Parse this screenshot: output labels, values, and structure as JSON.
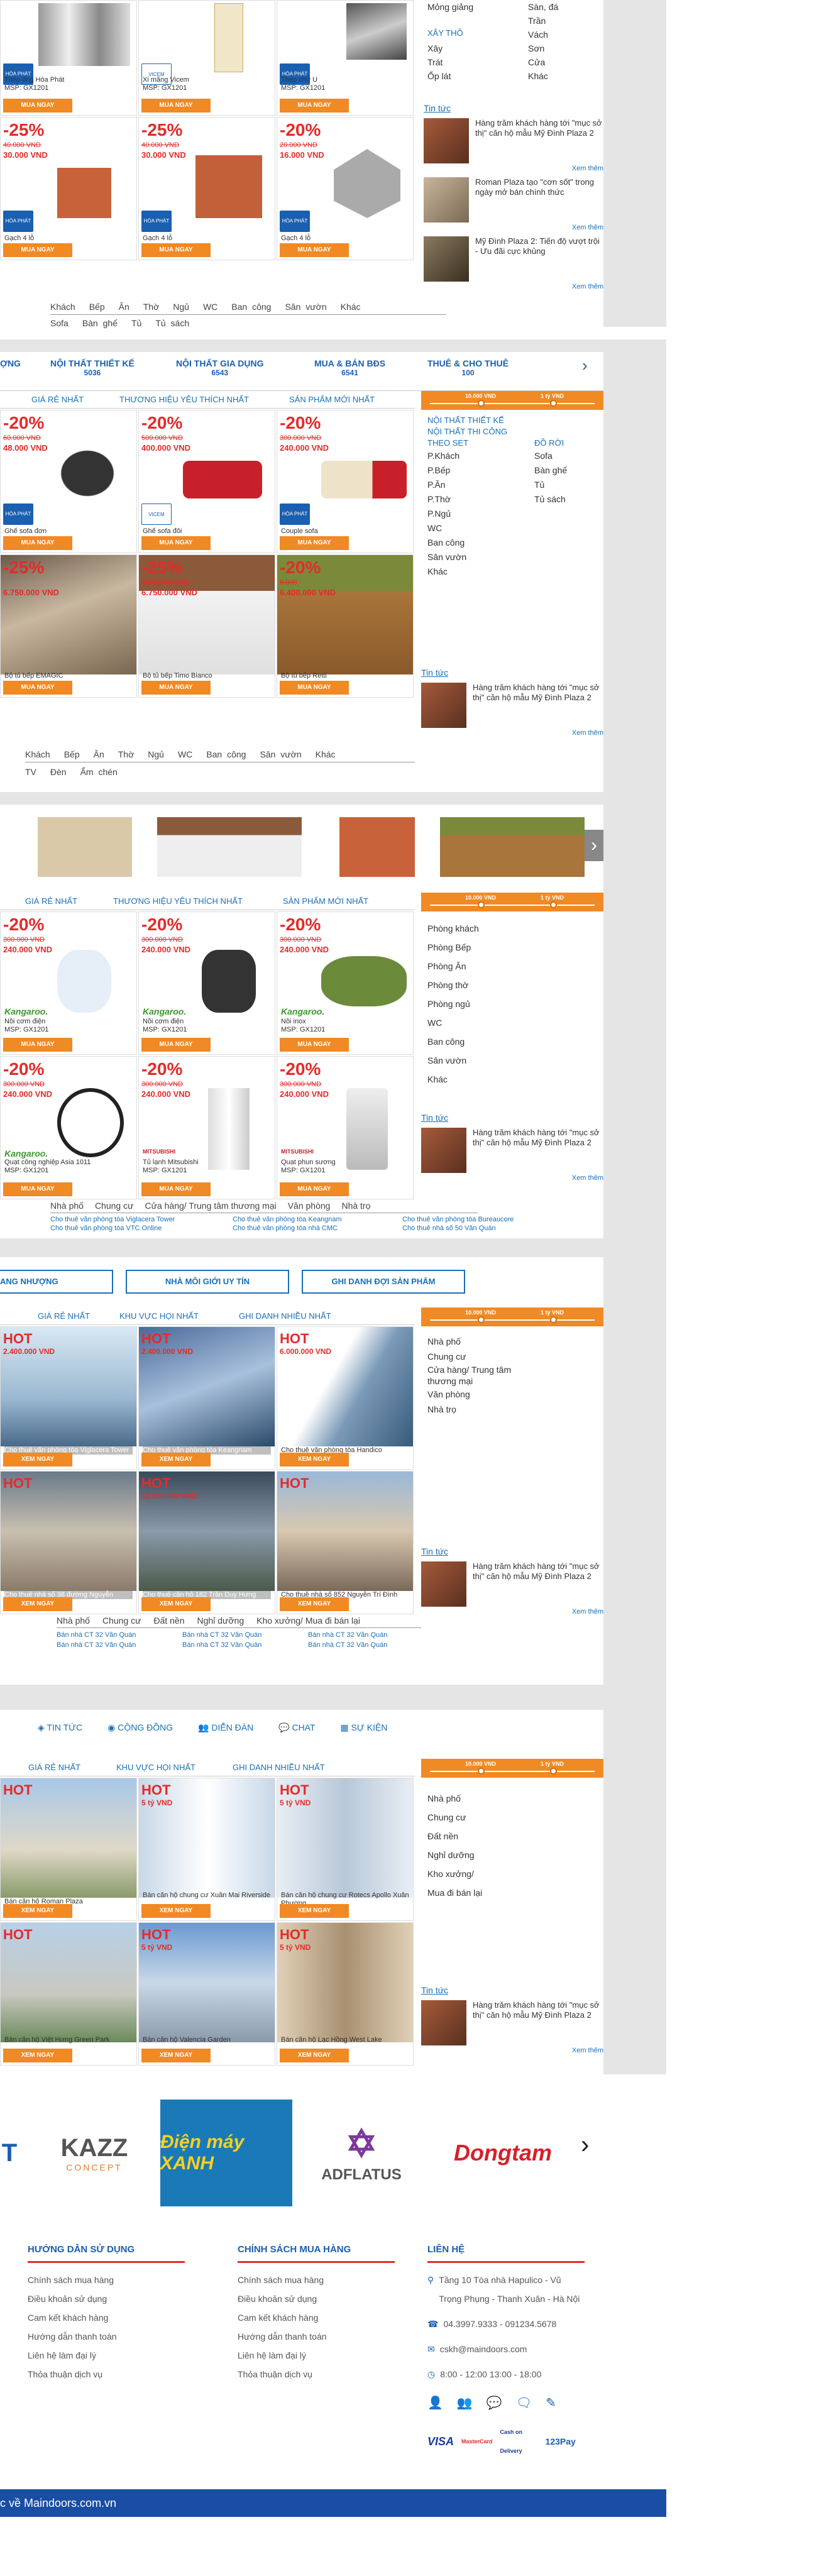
{
  "sec1": {
    "filters_top": [
      "Mỏng giảng",
      "Sàn, đá",
      "Trần",
      "Vách",
      "Sơn",
      "Cửa",
      "Khác"
    ],
    "filter_title": "XÂY THÔ",
    "filter_items": [
      "Xây",
      "Trát",
      "Ốp lát"
    ],
    "news_title": "Tin tức",
    "news": [
      "Hàng trăm khách hàng tới \"mục sở thị\" căn hộ mẫu Mỹ Đình Plaza 2",
      "Roman Plaza tạo \"cơn sốt\" trong ngày mở bán chính thức",
      "Mỹ Đình Plaza 2: Tiến độ vượt trội - Ưu đãi cực khủng"
    ],
    "more": "Xem thêm",
    "cards_top": [
      {
        "name": "Thép ống Hòa Phát",
        "sku": "MSP: GX1201",
        "btn": "MUA NGAY"
      },
      {
        "name": "Xi măng Vicem",
        "sku": "MSP: GX1201",
        "btn": "MUA NGAY"
      },
      {
        "name": "Thép chữ U",
        "sku": "MSP: GX1201",
        "btn": "MUA NGAY"
      }
    ],
    "cards": [
      {
        "disc": "-25%",
        "old": "40.000 VND",
        "new": "30.000 VND",
        "name": "Gạch 4 lỗ",
        "sku": "MSP: GX1201",
        "btn": "MUA NGAY"
      },
      {
        "disc": "-25%",
        "old": "40.000 VND",
        "new": "30.000 VND",
        "name": "Gạch 4 lỗ",
        "sku": "MSP: GX1201",
        "btn": "MUA NGAY"
      },
      {
        "disc": "-20%",
        "old": "20.000 VND",
        "new": "16.000 VND",
        "name": "Gạch 4 lỗ",
        "sku": "MSP: GX1201",
        "btn": "MUA NGAY"
      }
    ],
    "cats1": [
      "Khách",
      "Bếp",
      "Ăn",
      "Thờ",
      "Ngủ",
      "WC",
      "Ban công",
      "Sân vườn",
      "Khác"
    ],
    "cats2": [
      "Sofa",
      "Bàn ghế",
      "Tủ",
      "Tủ sách"
    ]
  },
  "sec2": {
    "menu": [
      {
        "label": "ỢNG",
        "count": ""
      },
      {
        "label": "NỘI THẤT THIẾT KẾ",
        "count": "5036"
      },
      {
        "label": "NỘI THẤT GIA DỤNG",
        "count": "6543"
      },
      {
        "label": "MUA & BÁN BĐS",
        "count": "6541"
      },
      {
        "label": "THUÊ & CHO THUÊ",
        "count": "100"
      }
    ],
    "tabs": [
      "GIÁ RẺ NHẤT",
      "THƯƠNG HIỆU YÊU THÍCH NHẤT",
      "SẢN PHẨM MỚI NHẤT"
    ],
    "range_min": "10.000 VND",
    "range_max": "1 tỷ VND",
    "f_titles": [
      "NỘI THẤT THIẾT KẾ",
      "NỘI THẤT THI CÔNG"
    ],
    "f_h1": "THEO SET",
    "f_h2": "ĐỒ RỜI",
    "f_left": [
      "P.Khách",
      "P.Bếp",
      "P.Ăn",
      "P.Thờ",
      "P.Ngủ",
      "WC",
      "Ban công",
      "Sân vườn",
      "Khác"
    ],
    "f_right": [
      "Sofa",
      "Bàn ghế",
      "Tủ",
      "Tủ sách"
    ],
    "cards": [
      {
        "disc": "-20%",
        "old": "60.000 VND",
        "new": "48.000 VND",
        "name": "Ghế sofa đơn",
        "sku": "MSP: GX1201",
        "btn": "MUA NGAY"
      },
      {
        "disc": "-20%",
        "old": "500.000 VND",
        "new": "400.000 VND",
        "name": "Ghế sofa đôi",
        "sku": "MSP: GX1201",
        "btn": "MUA NGAY"
      },
      {
        "disc": "-20%",
        "old": "300.000 VND",
        "new": "240.000 VND",
        "name": "Couple sofa",
        "sku": "MSP: GX1201",
        "btn": "MUA NGAY"
      },
      {
        "disc": "-25%",
        "old": "",
        "new": "6.750.000 VND",
        "name": "Bộ tủ bếp EMAGIC",
        "sku": "MSP: GX1201",
        "btn": "MUA NGAY"
      },
      {
        "disc": "-25%",
        "old": "9.000.000 VND",
        "new": "6.750.000 VND",
        "name": "Bộ tủ bếp Timo Bianco",
        "sku": "MSP: GX1201",
        "btn": "MUA NGAY"
      },
      {
        "disc": "-20%",
        "old": "8.000",
        "new": "6.400.000 VND",
        "name": "Bộ tủ bếp Retti",
        "sku": "MSP: GX1201",
        "btn": "MUA NGAY"
      }
    ],
    "cats1": [
      "Khách",
      "Bếp",
      "Ăn",
      "Thờ",
      "Ngủ",
      "WC",
      "Ban công",
      "Sân vườn",
      "Khác"
    ],
    "cats2": [
      "TV",
      "Đèn",
      "Ẩm chén"
    ]
  },
  "sec3": {
    "tabs": [
      "GIÁ RẺ NHẤT",
      "THƯƠNG HIỆU YÊU THÍCH NHẤT",
      "SẢN PHẨM MỚI NHẤT"
    ],
    "rooms": [
      "Phòng khách",
      "Phòng Bếp",
      "Phòng Ăn",
      "Phòng thờ",
      "Phòng ngủ",
      "WC",
      "Ban công",
      "Sân vườn",
      "Khác"
    ],
    "cards": [
      {
        "disc": "-20%",
        "old": "300.000 VND",
        "new": "240.000 VND",
        "name": "Nồi cơm điện",
        "sku": "MSP: GX1201",
        "btn": "MUA NGAY",
        "brand": "Kangaroo."
      },
      {
        "disc": "-20%",
        "old": "300.000 VND",
        "new": "240.000 VND",
        "name": "Nồi cơm điện",
        "sku": "MSP: GX1201",
        "btn": "MUA NGAY",
        "brand": "Kangaroo."
      },
      {
        "disc": "-20%",
        "old": "300.000 VND",
        "new": "240.000 VND",
        "name": "Nồi inox",
        "sku": "MSP: GX1201",
        "btn": "MUA NGAY",
        "brand": "Kangaroo."
      },
      {
        "disc": "-20%",
        "old": "300.000 VND",
        "new": "240.000 VND",
        "name": "Quạt công nghiệp Asia 1011",
        "sku": "MSP: GX1201",
        "btn": "MUA NGAY",
        "brand": "Kangaroo."
      },
      {
        "disc": "-20%",
        "old": "300.000 VND",
        "new": "240.000 VND",
        "name": "Tủ lạnh Mitsubishi",
        "sku": "MSP: GX1201",
        "btn": "MUA NGAY",
        "brand": "MITSUBISHI"
      },
      {
        "disc": "-20%",
        "old": "300.000 VND",
        "new": "240.000 VND",
        "name": "Quạt phun sương",
        "sku": "MSP: GX1201",
        "btn": "MUA NGAY",
        "brand": "MITSUBISHI"
      }
    ],
    "links_head": [
      "Nhà phố",
      "Chung cư",
      "Cửa hàng/ Trung tâm thương mại",
      "Văn phòng",
      "Nhà trọ"
    ],
    "links": [
      "Cho thuê văn phòng tòa Viglacera Tower",
      "Cho thuê văn phòng tòa Keangnam",
      "Cho thuê văn phòng tòa Bureaucore",
      "Cho thuê văn phòng tòa VTC Online",
      "Cho thuê văn phòng tòa nhà CMC",
      "Cho thuê nhà số 50 Văn Quán"
    ]
  },
  "sec4": {
    "buttons": [
      "ANG NHƯỢNG",
      "NHÀ MÔI GIỚI UY TÍN",
      "GHI DANH ĐỢI SẢN PHẨM"
    ],
    "tabs": [
      "GIÁ RẺ NHẤT",
      "KHU VỰC HỌI NHẤT",
      "GHI DANH NHIỀU NHẤT"
    ],
    "types": [
      "Nhà phố",
      "Chung cư",
      "Cửa hàng/ Trung tâm thương mại",
      "Văn phòng",
      "Nhà trọ"
    ],
    "cards": [
      {
        "hot": "HOT",
        "price": "2.400.000 VND",
        "name": "Cho thuê văn phòng tòa Viglacera Tower",
        "btn": "XEM NGAY"
      },
      {
        "hot": "HOT",
        "price": "2.400.000 VND",
        "name": "Cho thuê văn phòng tòa Keangnam",
        "btn": "XEM NGAY"
      },
      {
        "hot": "HOT",
        "price": "6.000.000 VND",
        "name": "Cho thuê văn phòng tòa Handico",
        "btn": "XEM NGAY"
      },
      {
        "hot": "HOT",
        "price": "",
        "name": "Cho thuê nhà số 38 đường Nguyễn",
        "btn": "XEM NGAY"
      },
      {
        "hot": "HOT",
        "price": "12.000.000 VND",
        "name": "Cho thuê căn hộ 182 Trần Duy Hưng",
        "btn": "XEM NGAY"
      },
      {
        "hot": "HOT",
        "price": "",
        "name": "Cho thuê nhà số 852 Nguyễn Trí Đình",
        "btn": "XEM NGAY"
      }
    ],
    "cats": [
      "Nhà phố",
      "Chung cư",
      "Đất nền",
      "Nghỉ dưỡng",
      "Kho xưởng/ Mua đi bán lại"
    ],
    "links": [
      "Bán nhà CT 32 Văn Quán",
      "Bán nhà CT 32 Văn Quán",
      "Bán nhà CT 32 Văn Quán",
      "Bán nhà CT 32 Văn Quán",
      "Bán nhà CT 32 Văn Quán",
      "Bán nhà CT 32 Văn Quán"
    ]
  },
  "sec5": {
    "iconbar": [
      "TIN TỨC",
      "CỘNG ĐỒNG",
      "DIỄN ĐÀN",
      "CHAT",
      "SỰ KIỆN"
    ],
    "tabs": [
      "GIÁ RẺ NHẤT",
      "KHU VỰC HỌI NHẤT",
      "GHI DANH NHIỀU NHẤT"
    ],
    "types": [
      "Nhà phố",
      "Chung cư",
      "Đất nền",
      "Nghỉ dưỡng",
      "Kho xưởng/",
      "Mua đi bán lại"
    ],
    "cards": [
      {
        "hot": "HOT",
        "price": "",
        "name": "Bán căn hộ Roman Plaza",
        "btn": "XEM NGAY"
      },
      {
        "hot": "HOT",
        "price": "5 tỷ VND",
        "name": "Bán căn hộ chung cư Xuân Mai Riverside",
        "btn": "XEM NGAY"
      },
      {
        "hot": "HOT",
        "price": "5 tỷ VND",
        "name": "Bán căn hộ chung cư Rotecs Apollo Xuân Phương",
        "btn": "XEM NGAY"
      },
      {
        "hot": "HOT",
        "price": "",
        "name": "Bán căn hộ Việt Hưng Green Park",
        "btn": "XEM NGAY"
      },
      {
        "hot": "HOT",
        "price": "5 tỷ VND",
        "name": "Bán căn hộ Valencia Garden",
        "btn": "XEM NGAY"
      },
      {
        "hot": "HOT",
        "price": "5 tỷ VND",
        "name": "Bán căn hộ Lạc Hồng West Lake",
        "btn": "XEM NGAY"
      }
    ]
  },
  "brands": [
    "KAZZ",
    "CONCEPT",
    "Điện máy XANH",
    "ADFLATUS",
    "Dongtam"
  ],
  "footer": {
    "col1": {
      "title": "HƯỚNG DẪN SỬ DỤNG",
      "items": [
        "Chính sách mua hàng",
        "Điều khoản sử dụng",
        "Cam kết khách hàng",
        "Hướng dẫn thanh toán",
        "Liên hệ làm đại lý",
        "Thỏa thuận dịch vụ"
      ]
    },
    "col2": {
      "title": "CHÍNH SÁCH MUA HÀNG",
      "items": [
        "Chính sách mua hàng",
        "Điều khoản sử dụng",
        "Cam kết khách hàng",
        "Hướng dẫn thanh toán",
        "Liên hệ làm đại lý",
        "Thỏa thuận dịch vụ"
      ]
    },
    "col3": {
      "title": "LIÊN HỆ",
      "address": "Tầng 10 Tòa nhà Hapulico - Vũ Trọng Phụng - Thanh Xuân - Hà Nội",
      "phone": "04.3997.9333 - 091234.5678",
      "email": "cskh@maindoors.com",
      "hours": "8:00 - 12:00 13:00 - 18:00"
    },
    "payments": [
      "VISA",
      "MasterCard",
      "Cash on Delivery",
      "123Pay"
    ],
    "bar": "c về Maindoors.com.vn"
  }
}
